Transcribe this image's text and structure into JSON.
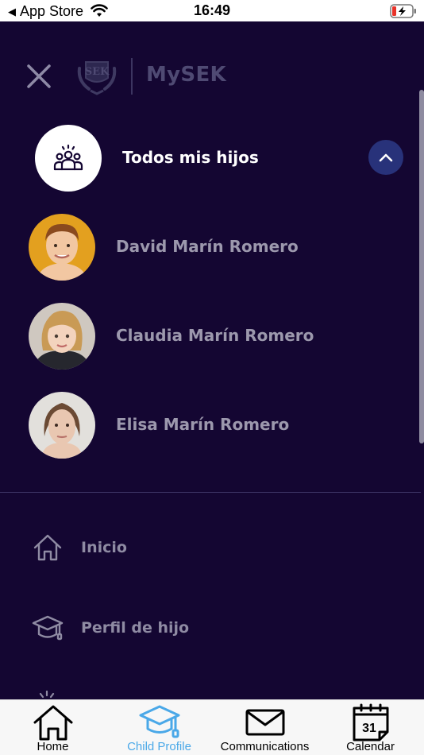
{
  "status_bar": {
    "back_app": "App Store",
    "time": "16:49"
  },
  "drawer": {
    "brand": "MySEK",
    "logo_text": "SEK",
    "all_children_label": "Todos mis hijos",
    "children": [
      {
        "name": "David Marín Romero",
        "avatar_bg": "#e3a01f",
        "hair": "#8a4a1e",
        "skin": "#f2c7a2"
      },
      {
        "name": "Claudia Marín Romero",
        "avatar_bg": "#cfc8c0",
        "hair": "#c99a55",
        "skin": "#f3d3bd"
      },
      {
        "name": "Elisa Marín Romero",
        "avatar_bg": "#e2e0dc",
        "hair": "#6b4a34",
        "skin": "#e9c7b1"
      }
    ],
    "menu": [
      {
        "label": "Inicio",
        "icon": "home-icon"
      },
      {
        "label": "Perfil de hijo",
        "icon": "graduation-cap-icon"
      }
    ]
  },
  "tab_bar": {
    "tabs": [
      {
        "label": "Home",
        "icon": "home-icon",
        "active": false
      },
      {
        "label": "Child Profile",
        "icon": "graduation-cap-icon",
        "active": true
      },
      {
        "label": "Communications",
        "icon": "envelope-icon",
        "active": false
      },
      {
        "label": "Calendar",
        "icon": "calendar-icon",
        "active": false,
        "day": "31"
      }
    ]
  },
  "colors": {
    "drawer_bg": "#140632",
    "accent_active": "#4aa8e8",
    "collapse_button": "#28327a"
  }
}
